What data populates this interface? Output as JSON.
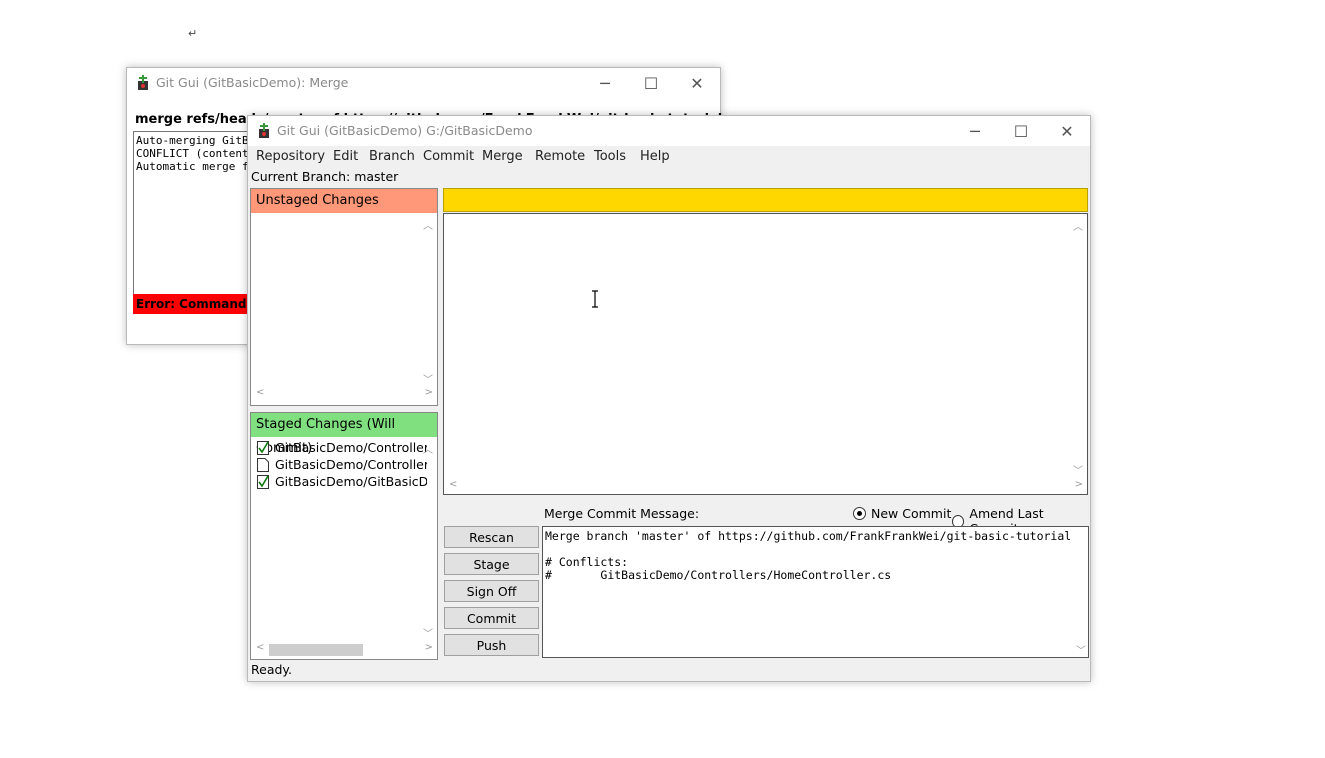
{
  "doc_mark": "↵",
  "merge_window": {
    "title": "Git Gui (GitBasicDemo): Merge",
    "heading": "merge refs/heads/master of https://github.com/FrankFrankWei/git-basic-tutorial",
    "log_lines": [
      "Auto-merging GitBasicDemo/Controllers/HomeController.cs",
      "CONFLICT (content): Merge conflict in GitBasicDemo/Controllers/HomeController.cs",
      "Automatic merge failed; fix conflicts and then commit the result."
    ],
    "error_text": "Error: Command Failed"
  },
  "main_window": {
    "title": "Git Gui (GitBasicDemo) G:/GitBasicDemo",
    "menu": [
      "Repository",
      "Edit",
      "Branch",
      "Commit",
      "Merge",
      "Remote",
      "Tools",
      "Help"
    ],
    "current_branch": "Current Branch: master",
    "unstaged_header": "Unstaged Changes",
    "staged_header": "Staged Changes (Will Commit)",
    "staged_files": [
      {
        "name": "GitBasicDemo/Controllers/HomeController.cs",
        "icon": "check-file-icon"
      },
      {
        "name": "GitBasicDemo/Controllers/HomeController.cs",
        "icon": "blank-file-icon"
      },
      {
        "name": "GitBasicDemo/GitBasicDemo.csproj",
        "icon": "check-file-icon"
      }
    ],
    "commit_label": "Merge Commit Message:",
    "radio_new": "New Commit",
    "radio_amend": "Amend Last Commit",
    "buttons": {
      "rescan": "Rescan",
      "stage_changed": "Stage Changed",
      "sign_off": "Sign Off",
      "commit": "Commit",
      "push": "Push"
    },
    "commit_message": "Merge branch 'master' of https://github.com/FrankFrankWei/git-basic-tutorial\n\n# Conflicts:\n#\tGitBasicDemo/Controllers/HomeController.cs",
    "status": "Ready."
  },
  "colors": {
    "unstaged_header": "#ff9878",
    "staged_header": "#80e080",
    "diff_header": "#ffd700",
    "error_bar": "#ff0000"
  }
}
